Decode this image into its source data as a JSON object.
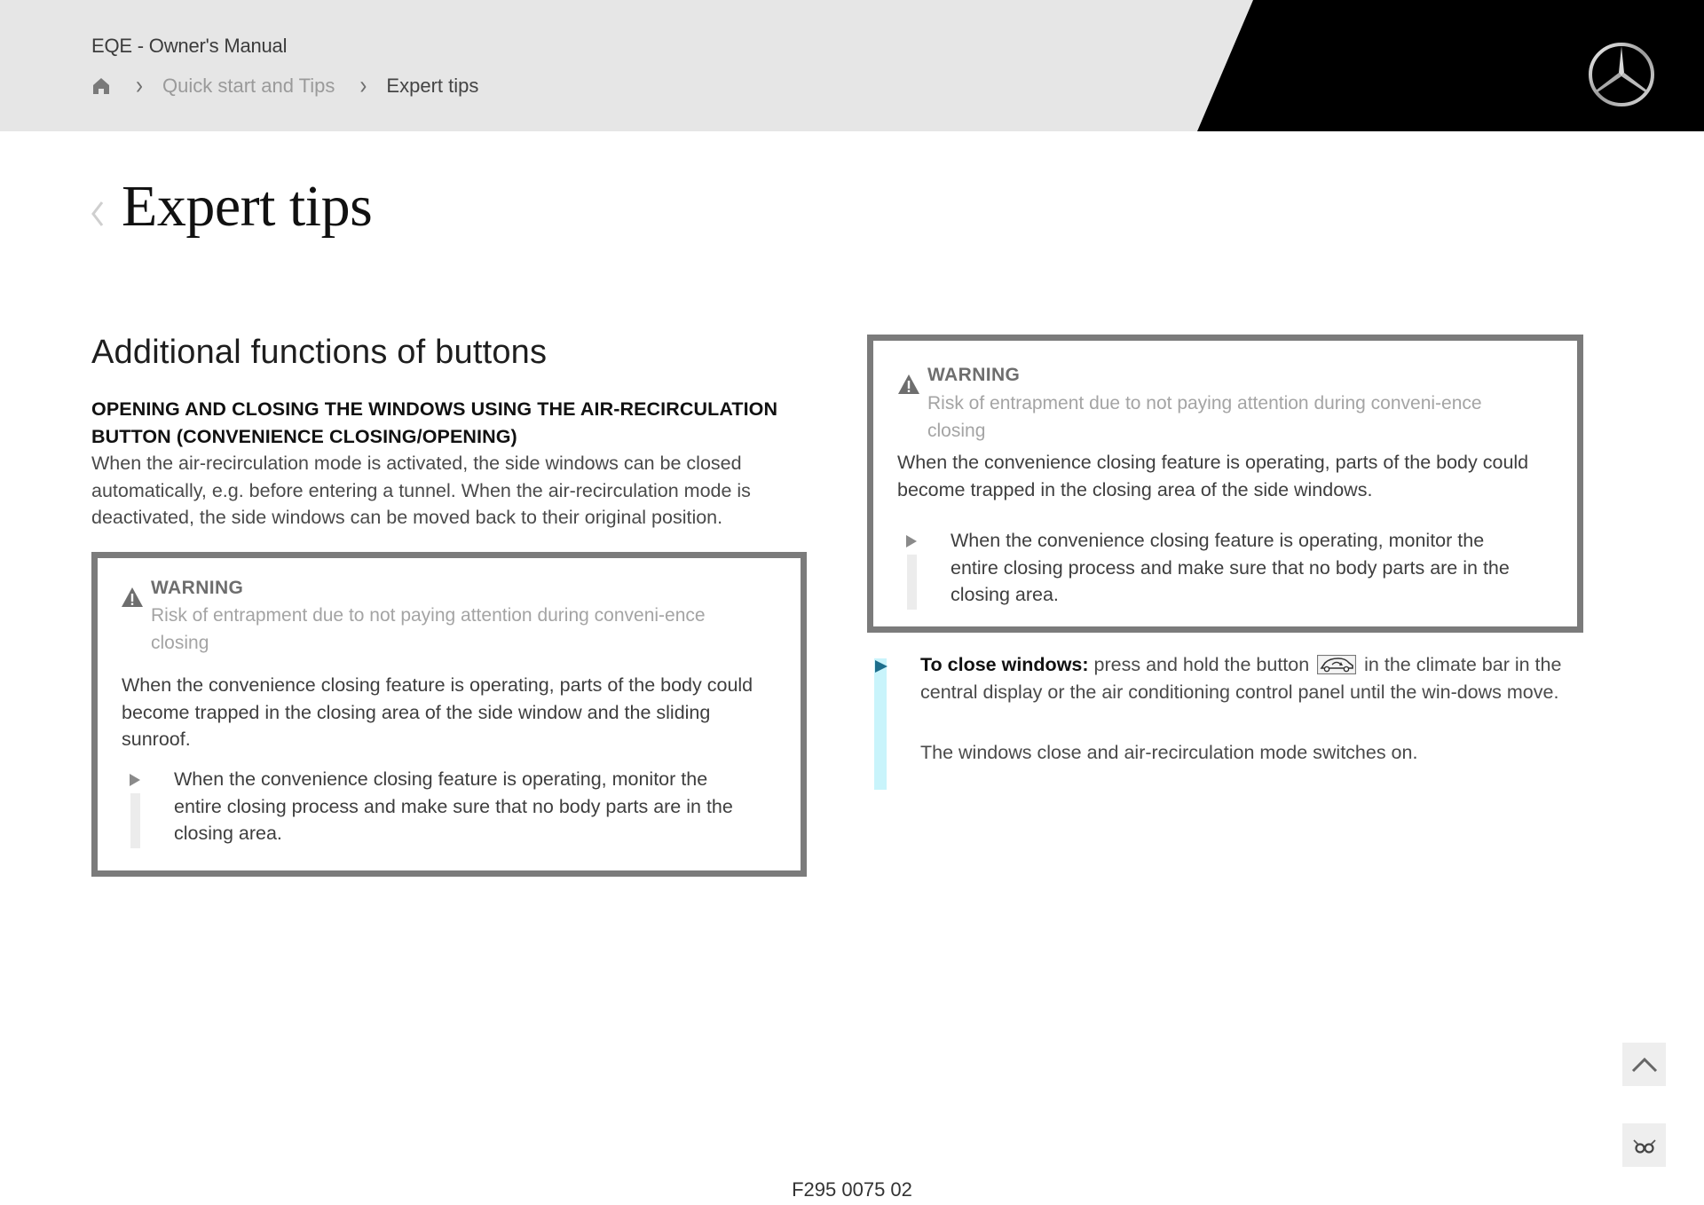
{
  "header": {
    "app_title": "EQE - Owner's Manual",
    "breadcrumb": [
      {
        "icon": "home-icon",
        "label": ""
      },
      {
        "label": "Quick start and Tips"
      },
      {
        "label": "Expert tips"
      }
    ],
    "brand_logo": "mercedes-star-logo",
    "brand_color": "#000000",
    "header_bg": "#e6e6e6"
  },
  "page": {
    "title": "Expert tips",
    "back_icon": "chevron-left-icon"
  },
  "section": {
    "title": "Additional functions of buttons",
    "sub_heading": "OPENING AND CLOSING THE WINDOWS USING THE AIR-RECIRCULATION BUTTON (CONVENIENCE CLOSING/OPENING)",
    "intro": "When the air-recirculation mode is activated, the side windows can be closed automatically, e.g. before entering a tunnel. When the air-recirculation mode is deactivated, the side windows can be moved back to their original position."
  },
  "warnings": [
    {
      "icon": "warning-triangle-icon",
      "label": "WARNING",
      "subtitle": "Risk of entrapment due to not paying attention during conveni-ence closing",
      "body": "When the convenience closing feature is operating, parts of the body could become trapped in the closing area of the side window and the sliding sunroof.",
      "step": "When the convenience closing feature is operating, monitor the entire closing process and make sure that no body parts are in the closing area."
    },
    {
      "icon": "warning-triangle-icon",
      "label": "WARNING",
      "subtitle": "Risk of entrapment due to not paying attention during conveni-ence closing",
      "body": "When the convenience closing feature is operating, parts of the body could become trapped in the closing area of the side windows.",
      "step": "When the convenience closing feature is operating, monitor the entire closing process and make sure that no body parts are in the closing area."
    }
  ],
  "instruction": {
    "lead": "To close windows:",
    "text_before_icon": "press and hold the button",
    "icon": "air-recirculation-icon",
    "text_after_icon": "in the climate bar in the central display or the air conditioning control panel until the win-dows move.",
    "result": "The windows close and air-recirculation mode switches on.",
    "accent_color": "#c9f4fb",
    "arrow_color": "#1d6e8c"
  },
  "side_buttons": [
    {
      "name": "scroll-top",
      "icon": "chevron-up-icon"
    },
    {
      "name": "reading-mode",
      "icon": "glasses-icon"
    }
  ],
  "footer": {
    "doc_code": "F295 0075 02"
  }
}
